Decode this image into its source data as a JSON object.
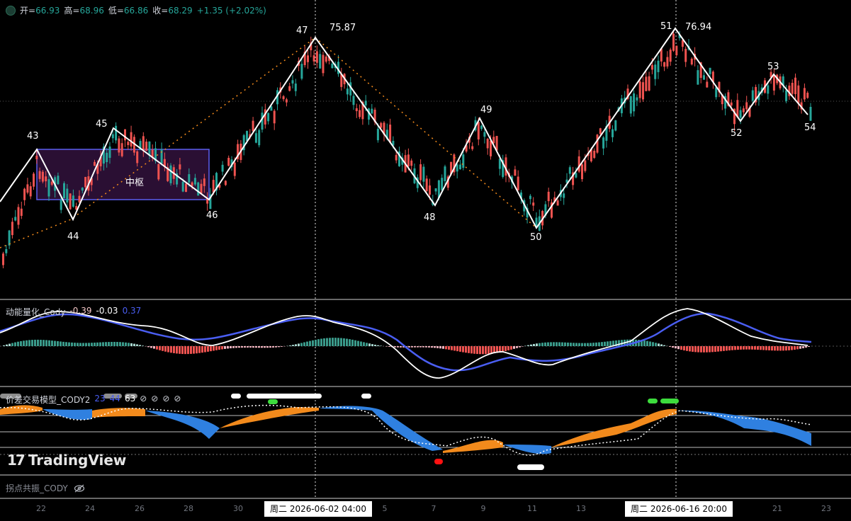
{
  "ohlc": {
    "open_label": "开=",
    "open": "66.93",
    "high_label": "高=",
    "high": "68.96",
    "low_label": "低=",
    "low": "66.86",
    "close_label": "收=",
    "close": "68.29",
    "change": "+1.35 (+2.02%)"
  },
  "pivot_labels": [
    {
      "text": "43"
    },
    {
      "text": "44"
    },
    {
      "text": "45"
    },
    {
      "text": "46"
    },
    {
      "text": "47"
    },
    {
      "text": "75.87"
    },
    {
      "text": "48"
    },
    {
      "text": "49"
    },
    {
      "text": "50"
    },
    {
      "text": "51"
    },
    {
      "text": "76.94"
    },
    {
      "text": "52"
    },
    {
      "text": "53"
    },
    {
      "text": "54"
    }
  ],
  "zone_label": "中枢",
  "indicator1": {
    "name": "动能量化_Cody",
    "v1": "-0.39",
    "v2": "-0.03",
    "v3": "0.37"
  },
  "indicator2": {
    "name": "价差交易模型_CODY2",
    "v1": "23",
    "v2": "44",
    "v3": "63",
    "icons": [
      "slash-circle-icon",
      "slash-circle-icon",
      "slash-circle-icon",
      "slash-circle-icon"
    ]
  },
  "indicator3": {
    "name": "拐点共振_CODY",
    "icon": "eye-off-icon"
  },
  "logo_text": "TradingView",
  "x_ticks": [
    "22",
    "24",
    "26",
    "28",
    "30",
    "5",
    "7",
    "9",
    "11",
    "13",
    "21",
    "23"
  ],
  "date_tags": [
    "周二 2026-06-02   04:00",
    "周二 2026-06-16   20:00"
  ],
  "colors": {
    "up": "#26a69a",
    "down": "#ef5350",
    "zone_border": "#5b5ff0",
    "zone_fill": "#2a0f33",
    "ma_blue": "#4a5ef2",
    "orange": "#f28a1c",
    "area_blue": "#2f80e0"
  }
}
